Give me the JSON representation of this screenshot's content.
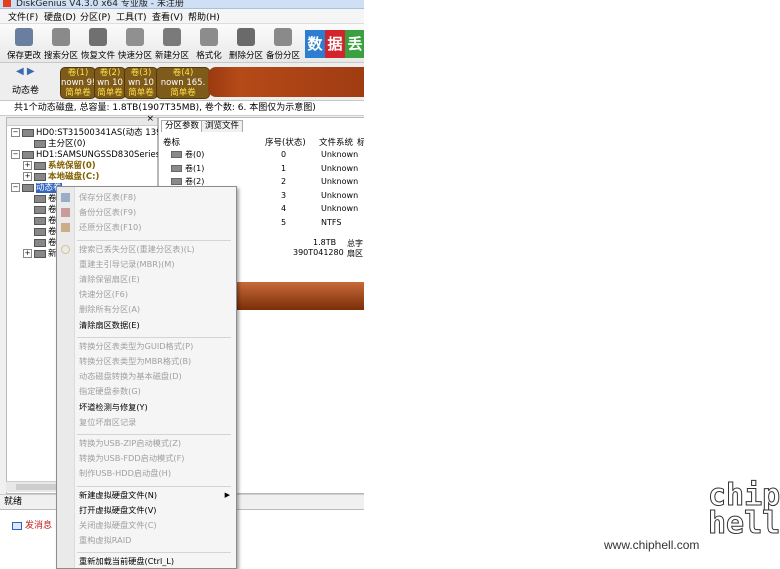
{
  "titlebar": {
    "title": "DiskGenius V4.3.0 x64 专业版 - 未注册"
  },
  "menu": [
    "文件(F)",
    "硬盘(D)",
    "分区(P)",
    "工具(T)",
    "查看(V)",
    "帮助(H)"
  ],
  "toolbar": [
    {
      "label": "保存更改",
      "icon": "save-icon",
      "color": "#6a7ea0"
    },
    {
      "label": "搜索分区",
      "icon": "search-icon",
      "color": "#8a8a8a"
    },
    {
      "label": "恢复文件",
      "icon": "recover-icon",
      "color": "#707070"
    },
    {
      "label": "快速分区",
      "icon": "pie-icon",
      "color": "#909090"
    },
    {
      "label": "新建分区",
      "icon": "new-partition-icon",
      "color": "#7a7a7a"
    },
    {
      "label": "格式化",
      "icon": "format-icon",
      "color": "#8c8c8c"
    },
    {
      "label": "删除分区",
      "icon": "trash-icon",
      "color": "#6a6a6a"
    },
    {
      "label": "备份分区",
      "icon": "backup-icon",
      "color": "#8a8a8a"
    }
  ],
  "ad": {
    "chars": [
      "数",
      "据",
      "丢"
    ],
    "colors": [
      "#2c7fd0",
      "#d2242a",
      "#3aa040"
    ]
  },
  "volume_strip": {
    "nav_arrows": "◀ ▶",
    "label": "动态卷",
    "volumes": [
      {
        "name": "卷(1)",
        "sub1": "nown 9!",
        "sub2": "简单卷"
      },
      {
        "name": "卷(2)",
        "sub1": "wn 10",
        "sub2": "简单卷"
      },
      {
        "name": "卷(3)",
        "sub1": "wn 10",
        "sub2": "简单卷"
      },
      {
        "name": "卷(4)",
        "sub1": "nown 165.",
        "sub2": "简单卷"
      }
    ]
  },
  "info_line": "共1个动态磁盘, 总容量: 1.8TB(1907T35MB), 卷个数: 6. 本图仅为示意图)",
  "tree": [
    {
      "text": "HD0:ST31500341AS(动态 139",
      "indent": 0,
      "exp": "−"
    },
    {
      "text": "主分区(0)",
      "indent": 1,
      "exp": ""
    },
    {
      "text": "HD1:SAMSUNGSSD830Series(1",
      "indent": 0,
      "exp": "−"
    },
    {
      "text": "系统保留(0)",
      "indent": 1,
      "exp": "+"
    },
    {
      "text": "本地磁盘(C:)",
      "indent": 1,
      "exp": "+"
    },
    {
      "text": "动态卷",
      "indent": 0,
      "exp": "−"
    },
    {
      "text": "卷",
      "indent": 1,
      "exp": ""
    },
    {
      "text": "卷",
      "indent": 1,
      "exp": ""
    },
    {
      "text": "卷",
      "indent": 1,
      "exp": ""
    },
    {
      "text": "卷",
      "indent": 1,
      "exp": ""
    },
    {
      "text": "卷",
      "indent": 1,
      "exp": ""
    },
    {
      "text": "新",
      "indent": 1,
      "exp": "+"
    }
  ],
  "tabs": [
    "分区参数",
    "浏览文件"
  ],
  "table": {
    "headers": [
      "卷标",
      "序号(状态)",
      "文件系统",
      "标"
    ],
    "rows": [
      {
        "label": "卷(0)",
        "seq": "0",
        "fs": "Unknown"
      },
      {
        "label": "卷(1)",
        "seq": "1",
        "fs": "Unknown"
      },
      {
        "label": "卷(2)",
        "seq": "2",
        "fs": "Unknown"
      },
      {
        "label": "",
        "seq": "3",
        "fs": "Unknown"
      },
      {
        "label": "",
        "seq": "4",
        "fs": "Unknown"
      },
      {
        "label": "",
        "seq": "5",
        "fs": "NTFS"
      }
    ]
  },
  "summary": {
    "size": "1.8TB",
    "sectors": "390T041280",
    "l1": "总字",
    "l2": "扇区"
  },
  "statusbar": "就绪",
  "bottom": {
    "send_msg": "发消息"
  },
  "context_menu": [
    {
      "label": "保存分区表(F8)",
      "enabled": false,
      "icon": true
    },
    {
      "label": "备份分区表(F9)",
      "enabled": false,
      "icon": true
    },
    {
      "label": "还原分区表(F10)",
      "enabled": false,
      "icon": true
    },
    {
      "sep": true
    },
    {
      "label": "搜索已丢失分区(重建分区表)(L)",
      "enabled": false,
      "icon": true
    },
    {
      "label": "重建主引导记录(MBR)(M)",
      "enabled": false
    },
    {
      "label": "清除保留扇区(E)",
      "enabled": false
    },
    {
      "label": "快速分区(F6)",
      "enabled": false
    },
    {
      "label": "删除所有分区(A)",
      "enabled": false
    },
    {
      "label": "清除扇区数据(E)",
      "enabled": true
    },
    {
      "sep": true
    },
    {
      "label": "转换分区表类型为GUID格式(P)",
      "enabled": false
    },
    {
      "label": "转换分区表类型为MBR格式(B)",
      "enabled": false
    },
    {
      "label": "动态磁盘转换为基本磁盘(D)",
      "enabled": false
    },
    {
      "label": "指定硬盘参数(G)",
      "enabled": false
    },
    {
      "label": "坏道检测与修复(Y)",
      "enabled": true
    },
    {
      "label": "复位坏扇区记录",
      "enabled": false
    },
    {
      "sep": true
    },
    {
      "label": "转换为USB-ZIP启动模式(Z)",
      "enabled": false
    },
    {
      "label": "转换为USB-FDD启动模式(F)",
      "enabled": false
    },
    {
      "label": "制作USB-HDD启动盘(H)",
      "enabled": false
    },
    {
      "sep": true
    },
    {
      "label": "新建虚拟硬盘文件(N)",
      "enabled": true,
      "submenu": true
    },
    {
      "label": "打开虚拟硬盘文件(V)",
      "enabled": true
    },
    {
      "label": "关闭虚拟硬盘文件(C)",
      "enabled": false
    },
    {
      "label": "重构虚拟RAID",
      "enabled": false
    },
    {
      "sep": true
    },
    {
      "label": "重新加载当前硬盘(Ctrl_L)",
      "enabled": true
    }
  ],
  "watermark": {
    "url": "www.chiphell.com",
    "logo": "chip hell"
  }
}
